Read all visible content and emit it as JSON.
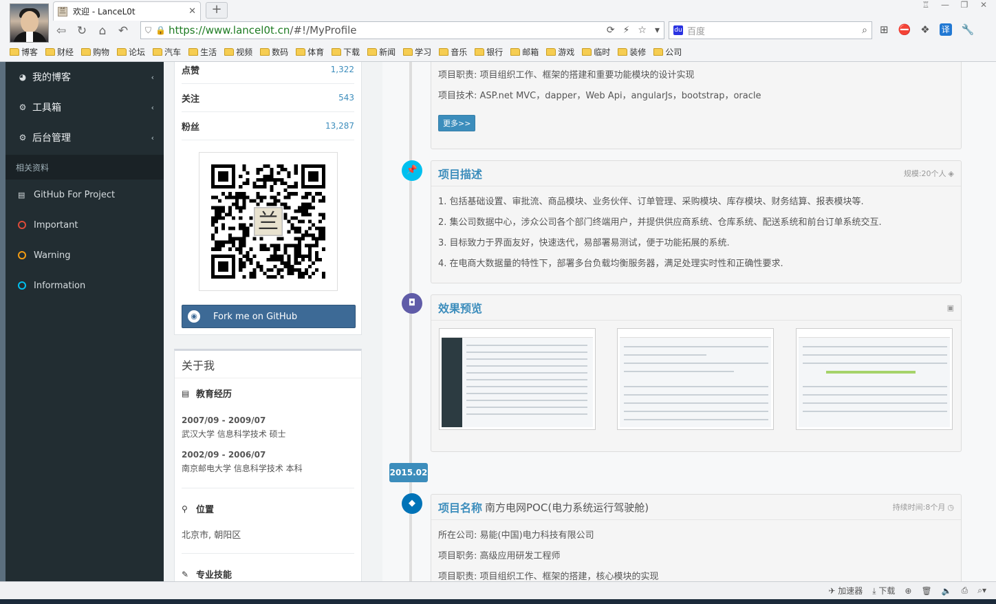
{
  "browser": {
    "tab_title": "欢迎 - LanceL0t",
    "url_host": "https://www.lancel0t.cn",
    "url_path": "/#!/MyProfile",
    "search_placeholder": "百度",
    "bookmarks": [
      "博客",
      "财经",
      "购物",
      "论坛",
      "汽车",
      "生活",
      "视频",
      "数码",
      "体育",
      "下载",
      "新闻",
      "学习",
      "音乐",
      "银行",
      "邮箱",
      "游戏",
      "临时",
      "装修",
      "公司"
    ],
    "ext_translate": "译",
    "status_accelerator": "加速器",
    "status_download": "下载"
  },
  "sidebar": {
    "menu": [
      {
        "label": "我的博客",
        "icon": "dashboard-icon"
      },
      {
        "label": "工具箱",
        "icon": "cogs-icon"
      },
      {
        "label": "后台管理",
        "icon": "gear-icon"
      }
    ],
    "section_header": "相关资料",
    "links": [
      {
        "label": "GitHub For Project",
        "kind": "book",
        "color": "#d7dde0"
      },
      {
        "label": "Important",
        "kind": "dot",
        "color": "#dd4b39"
      },
      {
        "label": "Warning",
        "kind": "dot",
        "color": "#f39c12"
      },
      {
        "label": "Information",
        "kind": "dot",
        "color": "#00c0ef"
      }
    ]
  },
  "profile": {
    "stats": [
      {
        "label": "点赞",
        "value": "1,322"
      },
      {
        "label": "关注",
        "value": "543"
      },
      {
        "label": "粉丝",
        "value": "13,287"
      }
    ],
    "github_button": "Fork me on GitHub",
    "about_title": "关于我",
    "education_title": "教育经历",
    "education": [
      {
        "date": "2007/09 - 2009/07",
        "desc": "武汉大学 信息科学技术 硕士"
      },
      {
        "date": "2002/09 - 2006/07",
        "desc": "南京邮电大学 信息科学技术 本科"
      }
    ],
    "location_title": "位置",
    "location": "北京市, 朝阳区",
    "skills_title": "专业技能"
  },
  "timeline": {
    "top_card": {
      "duty": "项目职责: 项目组织工作、框架的搭建和重要功能模块的设计实现",
      "tech": "项目技术: ASP.net MVC，dapper，Web Api，angularJs，bootstrap，oracle",
      "more_button": "更多>>"
    },
    "desc_card": {
      "title": "项目描述",
      "meta": "规模:20个人",
      "items": [
        "1. 包括基础设置、审批流、商品模块、业务伙伴、订单管理、采购模块、库存模块、财务结算、报表模块等.",
        "2. 集公司数据中心，涉众公司各个部门终端用户，并提供供应商系统、仓库系统、配送系统和前台订单系统交互.",
        "3. 目标致力于界面友好，快速迭代，易部署易测试，便于功能拓展的系统.",
        "4. 在电商大数据量的特性下，部署多台负载均衡服务器，满足处理实时性和正确性要求."
      ]
    },
    "preview_card": {
      "title": "效果预览"
    },
    "date_label": "2015.02",
    "project_card": {
      "title_key": "项目名称",
      "title_value": "南方电网POC(电力系统运行驾驶舱)",
      "meta": "持续时间:8个月",
      "company": "所在公司: 易能(中国)电力科技有限公司",
      "role": "项目职务: 高级应用研发工程师",
      "duty": "项目职责: 项目组织工作、框架的搭建，核心模块的实现"
    }
  }
}
